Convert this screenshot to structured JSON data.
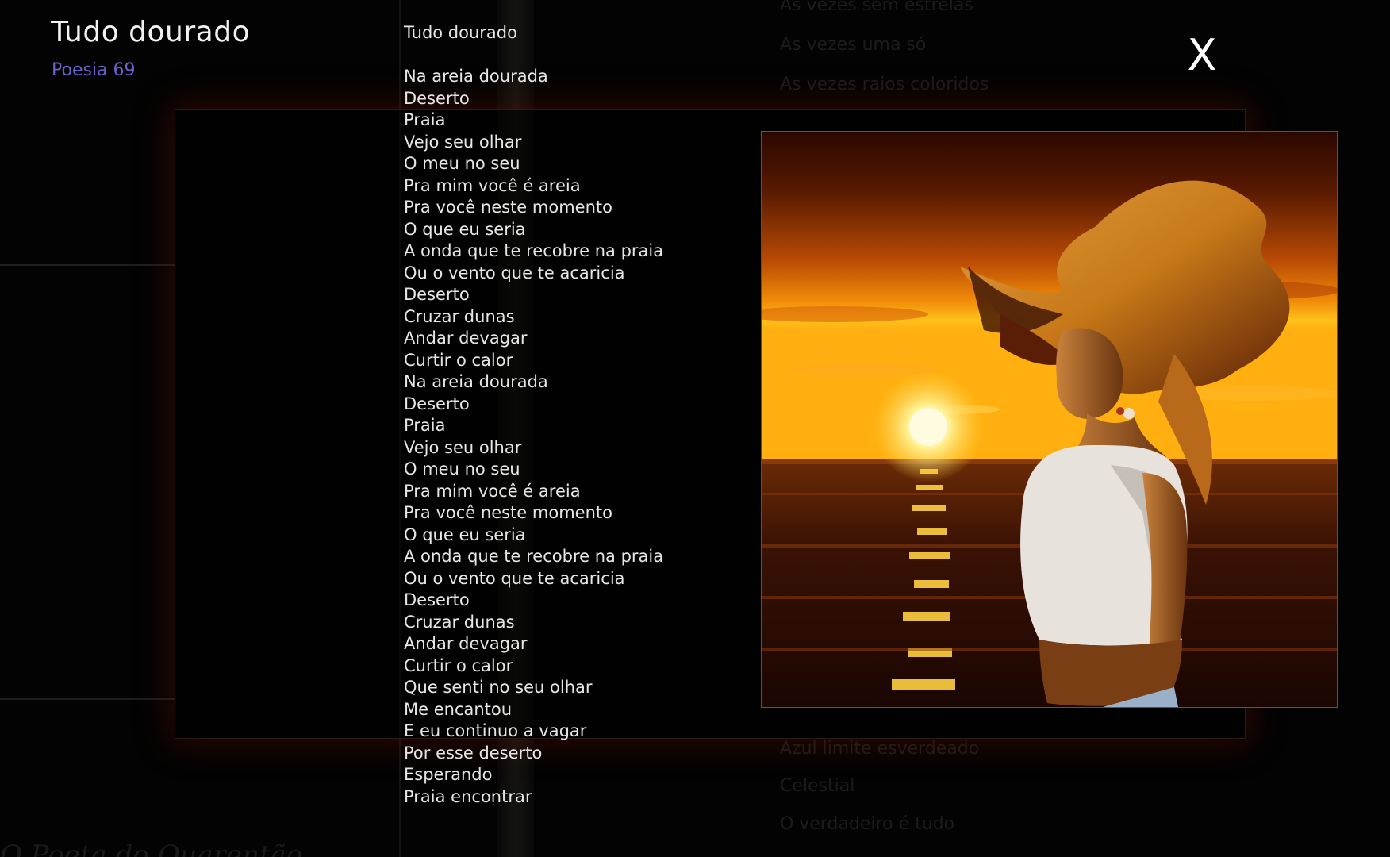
{
  "header": {
    "title": "Tudo dourado",
    "subtitle": "Poesia 69"
  },
  "close_label": "X",
  "poem": {
    "title": "Tudo dourado",
    "lines": [
      "Na areia dourada",
      "Deserto",
      "Praia",
      "Vejo seu olhar",
      "O meu no seu",
      "Pra mim você é areia",
      "Pra você neste momento",
      "O que eu seria",
      "A onda que te recobre na praia",
      "Ou o vento que te acaricia",
      "Deserto",
      "Cruzar dunas",
      "Andar devagar",
      "Curtir o calor",
      "Na areia dourada",
      "Deserto",
      "Praia",
      "Vejo seu olhar",
      "O meu no seu",
      "Pra mim você é areia",
      "Pra você neste momento",
      "O que eu seria",
      "A onda que te recobre na praia",
      "Ou o vento que te acaricia",
      "Deserto",
      "Cruzar dunas",
      "Andar devagar",
      "Curtir o calor",
      "Que senti no seu olhar",
      "Me encantou",
      "E eu continuo a vagar",
      "Por esse deserto",
      "Esperando",
      "Praia encontrar"
    ]
  },
  "background": {
    "lines_top": [
      "As vezes sem estrelas",
      "As vezes uma só",
      "As vezes raios coloridos"
    ],
    "lines_bottom": [
      "Azul limite esverdeado",
      "Celestial",
      "O verdadeiro é tudo"
    ],
    "footer_text": "O Poeta do Quarentão"
  },
  "colors": {
    "title": "#f2f2f2",
    "subtitle": "#6a63c9",
    "poem_text": "#e6e6e6",
    "background": "#030303"
  }
}
